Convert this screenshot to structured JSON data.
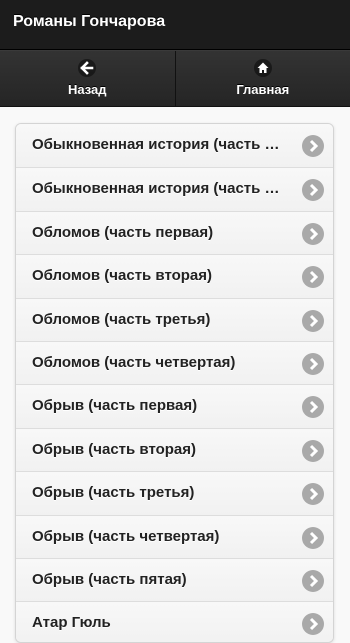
{
  "header": {
    "title": "Романы Гончарова"
  },
  "nav": {
    "back_label": "Назад",
    "back_icon": "arrow-left-icon",
    "home_label": "Главная",
    "home_icon": "home-icon"
  },
  "list": {
    "items": [
      {
        "label": "Обыкновенная история (часть первая)"
      },
      {
        "label": "Обыкновенная история (часть вторая)"
      },
      {
        "label": "Обломов (часть первая)"
      },
      {
        "label": "Обломов (часть вторая)"
      },
      {
        "label": "Обломов (часть третья)"
      },
      {
        "label": "Обломов (часть четвертая)"
      },
      {
        "label": "Обрыв (часть первая)"
      },
      {
        "label": "Обрыв (часть вторая)"
      },
      {
        "label": "Обрыв (часть третья)"
      },
      {
        "label": "Обрыв (часть четвертая)"
      },
      {
        "label": "Обрыв (часть пятая)"
      },
      {
        "label": "Атар Гюль"
      }
    ],
    "arrow_icon": "chevron-right-icon"
  },
  "colors": {
    "header_bg": "#1c1c1c",
    "navbar_bg": "#2a2a2a",
    "list_bg": "#f6f6f6",
    "arrow_bg": "#a9a9a9"
  }
}
